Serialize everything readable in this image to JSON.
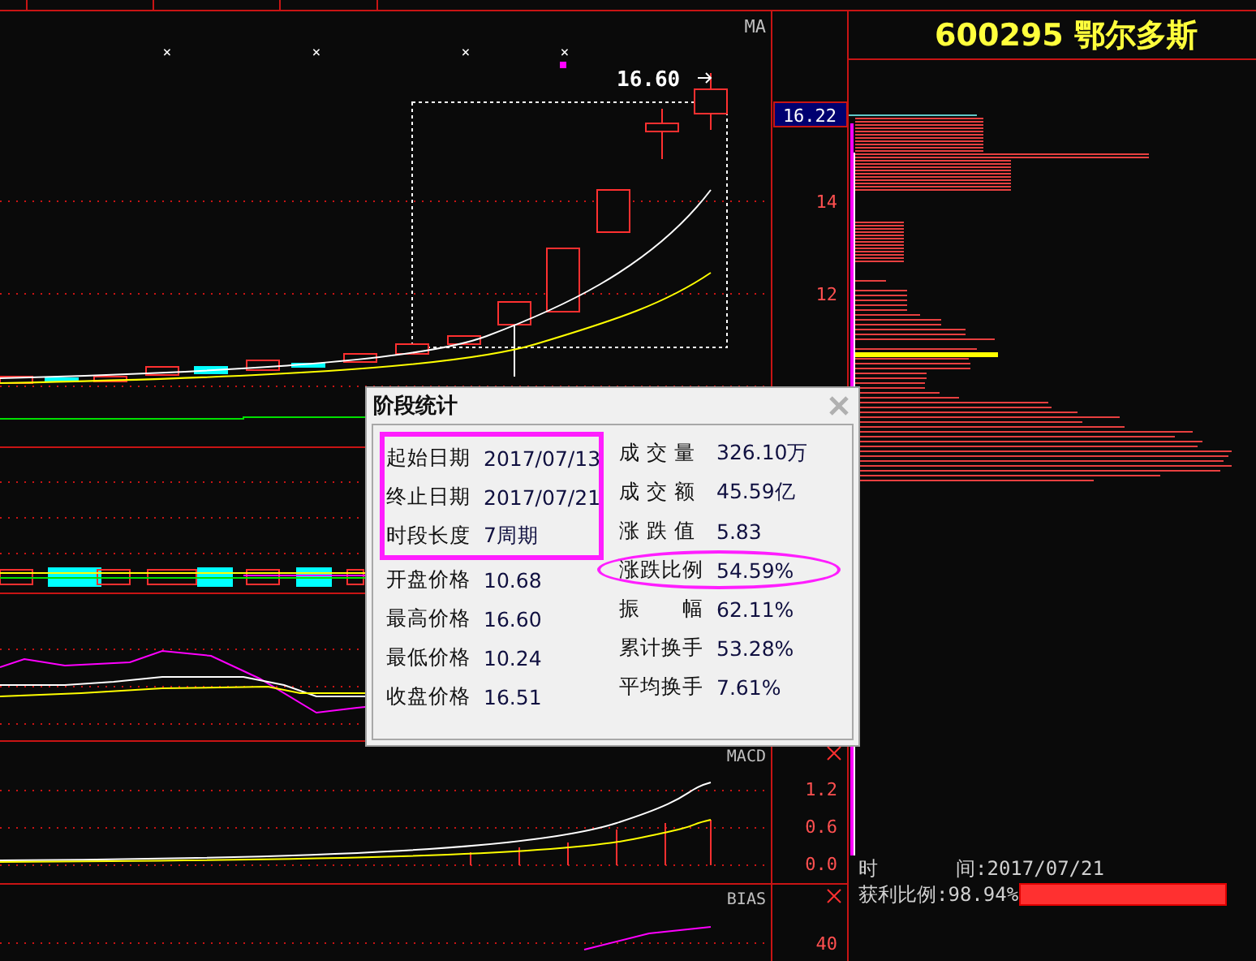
{
  "main_chart": {
    "indicator": "MA",
    "markers": [
      "×",
      "×",
      "×",
      "×"
    ],
    "high_label": "16.60",
    "current_price": "16.22",
    "axis_labels": [
      "14",
      "12"
    ]
  },
  "macd": {
    "title": "MACD",
    "axis_labels": [
      "1.2",
      "0.6",
      "0.0"
    ]
  },
  "bias": {
    "title": "BIAS",
    "axis_labels": [
      "40"
    ]
  },
  "stock": {
    "code": "600295",
    "name": "鄂尔多斯"
  },
  "chip_info": {
    "time_label": "时　　　　间:",
    "time_value": "2017/07/21",
    "profit_label": "获利比例:",
    "profit_value": "98.94%",
    "level": 0.9894
  },
  "dialog": {
    "title": "阶段统计",
    "left": [
      {
        "label": "起始日期",
        "value": "2017/07/13",
        "boxed": true
      },
      {
        "label": "终止日期",
        "value": "2017/07/21",
        "boxed": true
      },
      {
        "label": "时段长度",
        "value": "7周期",
        "boxed": true
      },
      {
        "label": "开盘价格",
        "value": "10.68",
        "boxed": false
      },
      {
        "label": "最高价格",
        "value": "16.60",
        "boxed": false
      },
      {
        "label": "最低价格",
        "value": "10.24",
        "boxed": false
      },
      {
        "label": "收盘价格",
        "value": "16.51",
        "boxed": false
      }
    ],
    "right": [
      {
        "label": "成 交 量",
        "value": "326.10万",
        "circled": false
      },
      {
        "label": "成 交 额",
        "value": "45.59亿",
        "circled": false
      },
      {
        "label": "涨 跌 值",
        "value": "5.83",
        "circled": false
      },
      {
        "label": "涨跌比例",
        "value": "54.59%",
        "circled": true
      },
      {
        "label": "振　　幅",
        "value": "62.11%",
        "circled": false
      },
      {
        "label": "累计换手",
        "value": "53.28%",
        "circled": false
      },
      {
        "label": "平均换手",
        "value": "7.61%",
        "circled": false
      }
    ]
  }
}
